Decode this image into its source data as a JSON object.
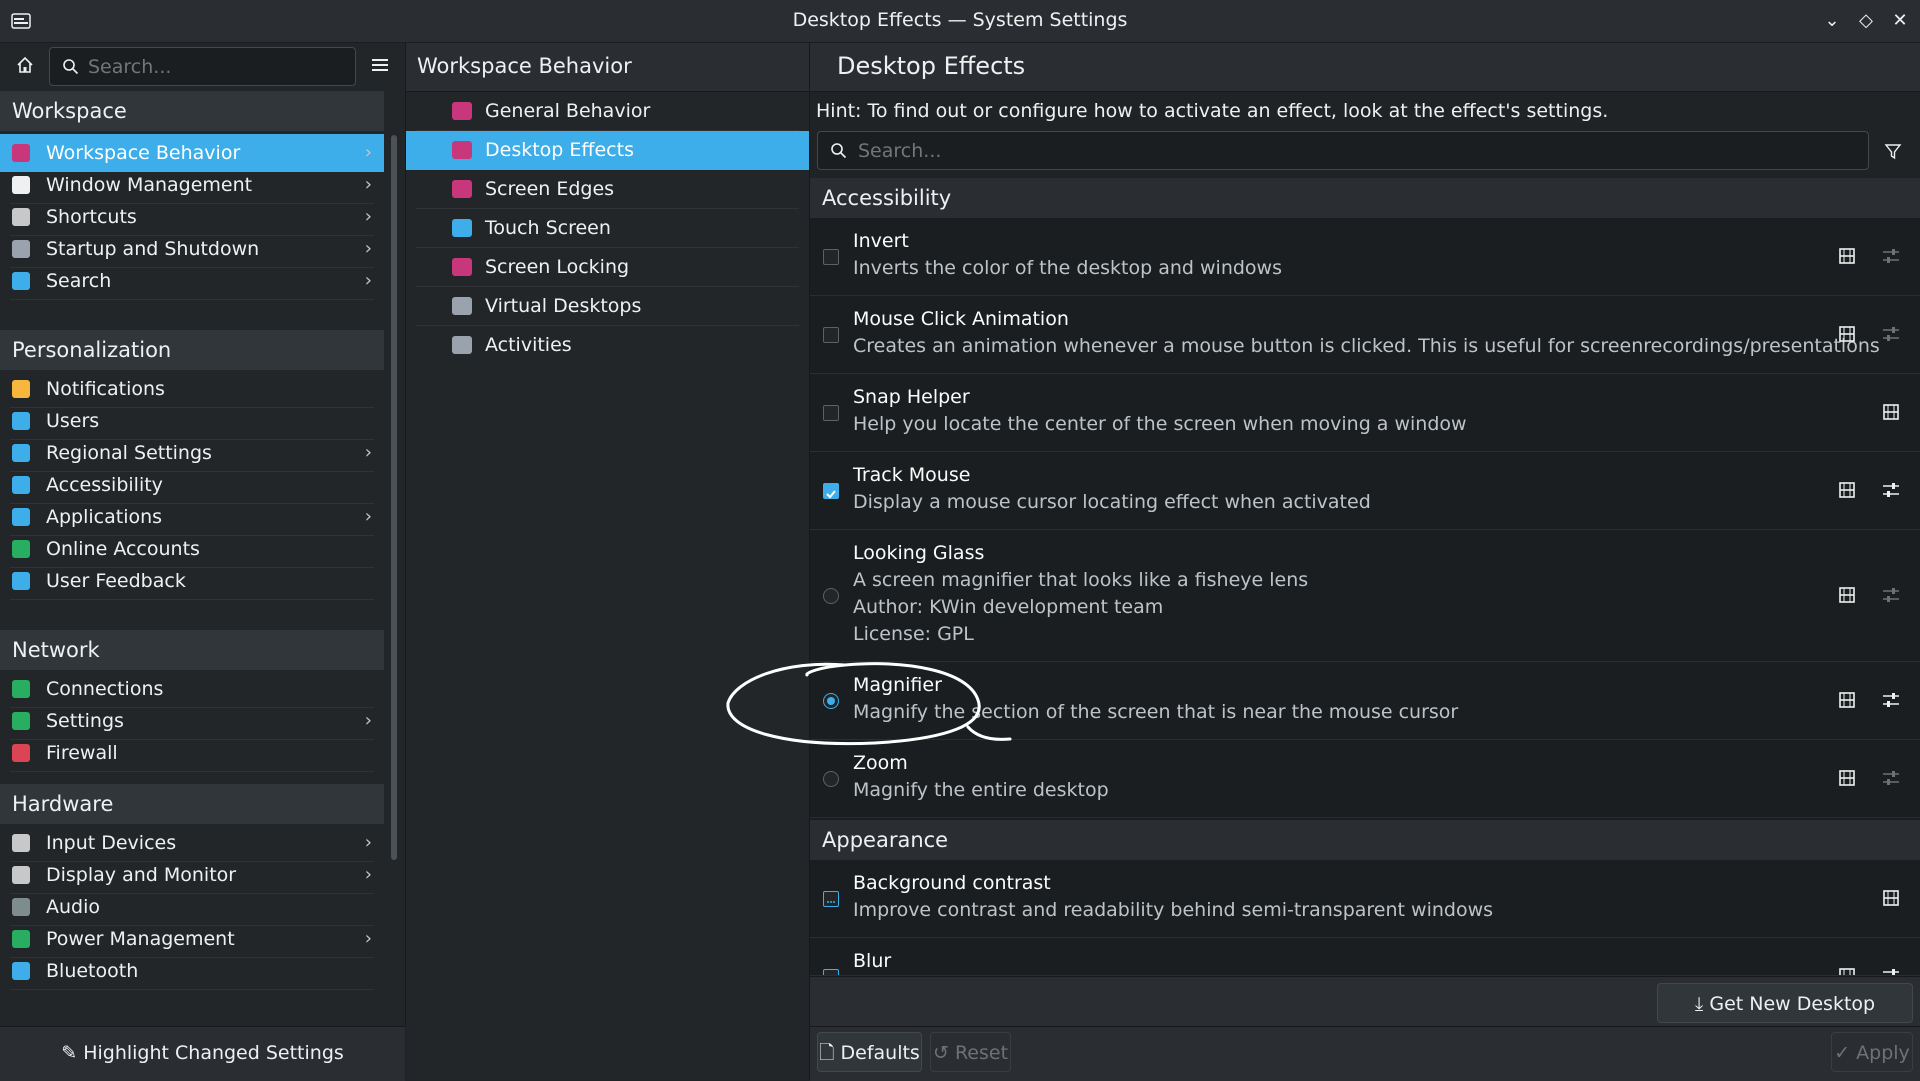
{
  "window": {
    "title": "Desktop Effects — System Settings"
  },
  "sidebar": {
    "search_placeholder": "Search...",
    "sections": [
      {
        "header": "Workspace",
        "items": [
          {
            "label": "Workspace Behavior",
            "chevron": true,
            "selected": true,
            "icon_color": "#c8377c"
          },
          {
            "label": "Window Management",
            "chevron": true,
            "icon_color": "#eff0f1"
          },
          {
            "label": "Shortcuts",
            "chevron": true,
            "icon_color": "#c6c8ca"
          },
          {
            "label": "Startup and Shutdown",
            "chevron": true,
            "icon_color": "#9aa3ad"
          },
          {
            "label": "Search",
            "chevron": true,
            "icon_color": "#3daee9"
          }
        ]
      },
      {
        "header": "Personalization",
        "items": [
          {
            "label": "Notifications",
            "chevron": false,
            "icon_color": "#f6b73c"
          },
          {
            "label": "Users",
            "chevron": false,
            "icon_color": "#3daee9"
          },
          {
            "label": "Regional Settings",
            "chevron": true,
            "icon_color": "#3daee9"
          },
          {
            "label": "Accessibility",
            "chevron": false,
            "icon_color": "#3daee9"
          },
          {
            "label": "Applications",
            "chevron": true,
            "icon_color": "#3daee9"
          },
          {
            "label": "Online Accounts",
            "chevron": false,
            "icon_color": "#27ae60"
          },
          {
            "label": "User Feedback",
            "chevron": false,
            "icon_color": "#3daee9"
          }
        ]
      },
      {
        "header": "Network",
        "items": [
          {
            "label": "Connections",
            "chevron": false,
            "icon_color": "#27ae60"
          },
          {
            "label": "Settings",
            "chevron": true,
            "icon_color": "#27ae60"
          },
          {
            "label": "Firewall",
            "chevron": false,
            "icon_color": "#da4453"
          }
        ]
      },
      {
        "header": "Hardware",
        "items": [
          {
            "label": "Input Devices",
            "chevron": true,
            "icon_color": "#c6c8ca"
          },
          {
            "label": "Display and Monitor",
            "chevron": true,
            "icon_color": "#c6c8ca"
          },
          {
            "label": "Audio",
            "chevron": false,
            "icon_color": "#7f8c8d"
          },
          {
            "label": "Power Management",
            "chevron": true,
            "icon_color": "#27ae60"
          },
          {
            "label": "Bluetooth",
            "chevron": false,
            "icon_color": "#3daee9"
          }
        ]
      }
    ],
    "footer_button": "Highlight Changed Settings"
  },
  "subnav": {
    "title": "Workspace Behavior",
    "items": [
      {
        "label": "General Behavior",
        "selected": false,
        "icon_color": "#c8377c"
      },
      {
        "label": "Desktop Effects",
        "selected": true,
        "icon_color": "#c8377c"
      },
      {
        "label": "Screen Edges",
        "selected": false,
        "icon_color": "#c8377c"
      },
      {
        "label": "Touch Screen",
        "selected": false,
        "icon_color": "#3daee9"
      },
      {
        "label": "Screen Locking",
        "selected": false,
        "icon_color": "#c8377c"
      },
      {
        "label": "Virtual Desktops",
        "selected": false,
        "icon_color": "#9aa3ad"
      },
      {
        "label": "Activities",
        "selected": false,
        "icon_color": "#9aa3ad"
      }
    ]
  },
  "main": {
    "title": "Desktop Effects",
    "hint": "Hint: To find out or configure how to activate an effect, look at the effect's settings.",
    "search_placeholder": "Search...",
    "categories": [
      {
        "name": "Accessibility",
        "effects": [
          {
            "name": "Invert",
            "desc": [
              "Inverts the color of the desktop and windows"
            ],
            "control": "checkbox",
            "checked": false,
            "configure": true,
            "configure_enabled": false
          },
          {
            "name": "Mouse Click Animation",
            "desc": [
              "Creates an animation whenever a mouse button is clicked. This is useful for screenrecordings/presentations"
            ],
            "control": "checkbox",
            "checked": false,
            "configure": true,
            "configure_enabled": false
          },
          {
            "name": "Snap Helper",
            "desc": [
              "Help you locate the center of the screen when moving a window"
            ],
            "control": "checkbox",
            "checked": false,
            "configure": false
          },
          {
            "name": "Track Mouse",
            "desc": [
              "Display a mouse cursor locating effect when activated"
            ],
            "control": "checkbox",
            "checked": true,
            "configure": true,
            "configure_enabled": true
          },
          {
            "name": "Looking Glass",
            "desc": [
              "A screen magnifier that looks like a fisheye lens",
              "Author: KWin development team",
              "License: GPL"
            ],
            "control": "radio",
            "checked": false,
            "configure": true,
            "configure_enabled": false
          },
          {
            "name": "Magnifier",
            "desc": [
              "Magnify the section of the screen that is near the mouse cursor"
            ],
            "control": "radio",
            "checked": true,
            "configure": true,
            "configure_enabled": true
          },
          {
            "name": "Zoom",
            "desc": [
              "Magnify the entire desktop"
            ],
            "control": "radio",
            "checked": false,
            "configure": true,
            "configure_enabled": false
          }
        ]
      },
      {
        "name": "Appearance",
        "effects": [
          {
            "name": "Background contrast",
            "desc": [
              "Improve contrast and readability behind semi-transparent windows"
            ],
            "control": "checkbox-partial",
            "checked": false,
            "configure": false
          },
          {
            "name": "Blur",
            "desc": [],
            "control": "checkbox-partial",
            "checked": false,
            "configure": true,
            "configure_enabled": true
          }
        ]
      }
    ],
    "get_new_button": "Get New Desktop Effects...",
    "defaults_button": "Defaults",
    "reset_button": "Reset",
    "apply_button": "Apply"
  },
  "colors": {
    "accent": "#3daee9",
    "background": "#1b1e20",
    "panel": "#232629",
    "header": "#2a2e32",
    "annotation": "#ffffff"
  },
  "annotation": {
    "type": "hand-drawn-ellipse",
    "target": "Magnifier"
  }
}
